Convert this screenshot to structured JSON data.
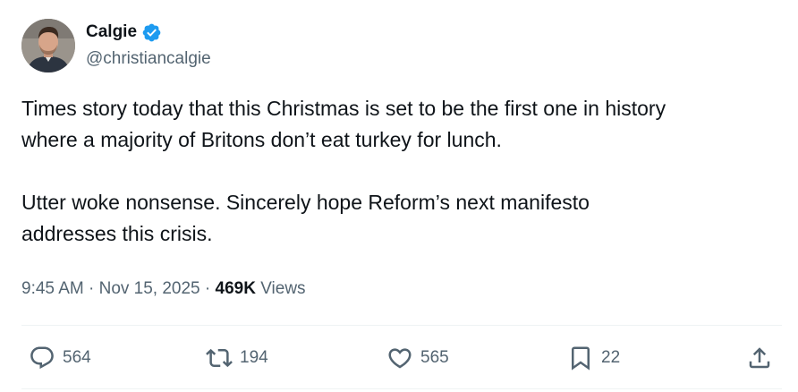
{
  "author": {
    "display_name": "Calgie",
    "handle": "@christiancalgie",
    "verified": true
  },
  "tweet": {
    "paragraphs": [
      "Times story today that this Christmas is set to be the first one in history\nwhere a majority of Britons don’t eat turkey for lunch.",
      "Utter woke nonsense. Sincerely hope Reform’s next manifesto\naddresses this crisis."
    ],
    "timestamp": "9:45 AM · Nov 15, 2025 · ",
    "views_count": "469K",
    "views_label": " Views"
  },
  "actions": {
    "replies": "564",
    "reposts": "194",
    "likes": "565",
    "bookmarks": "22"
  },
  "icons": {
    "verified": "verified-badge-icon",
    "reply": "reply-icon",
    "repost": "repost-icon",
    "like": "heart-icon",
    "bookmark": "bookmark-icon",
    "share": "share-icon"
  },
  "colors": {
    "text_primary": "#0f1419",
    "text_secondary": "#536471",
    "verified_blue": "#1d9bf0",
    "divider": "#eff3f4"
  }
}
